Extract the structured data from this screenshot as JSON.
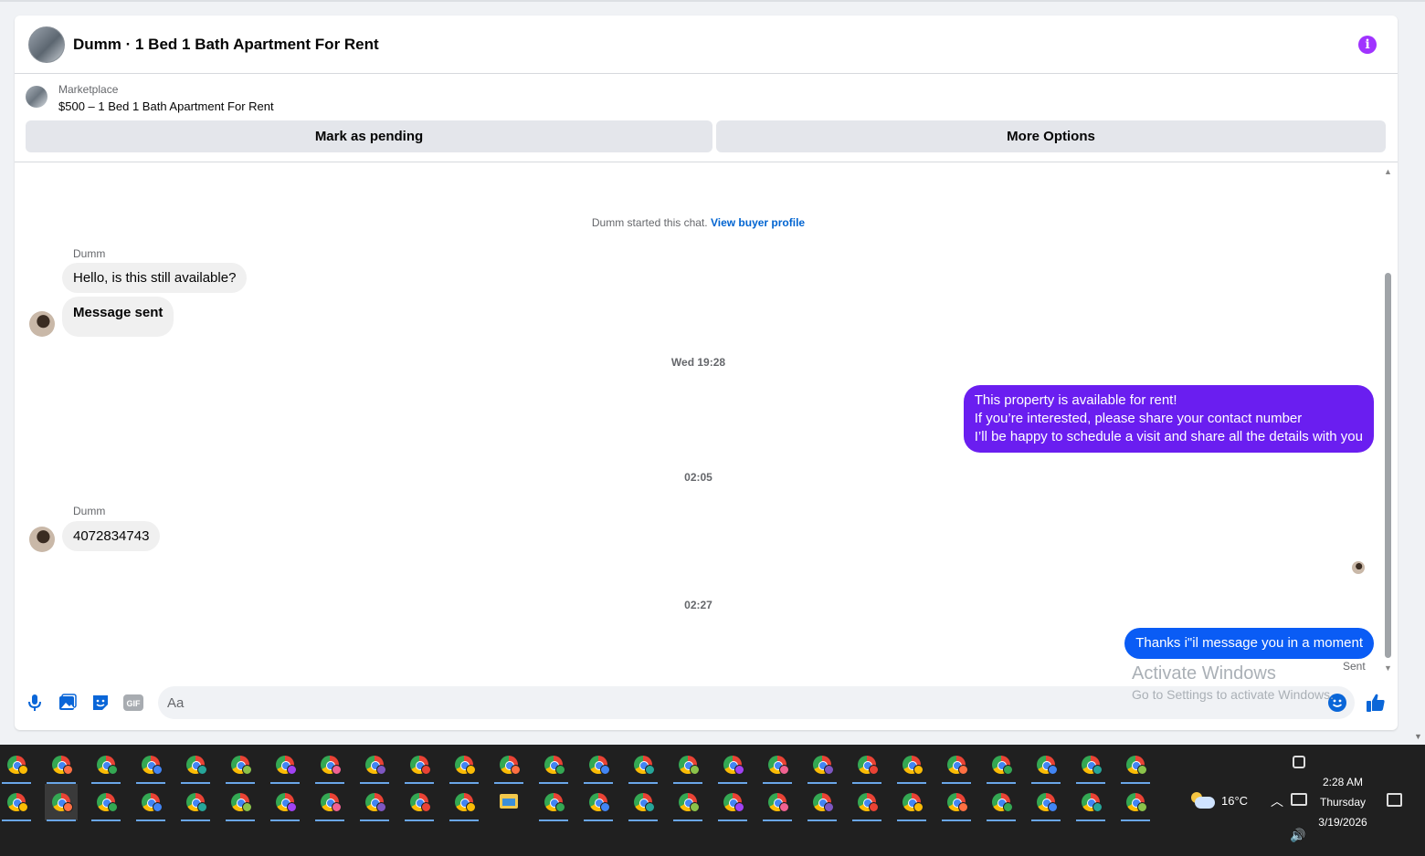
{
  "header": {
    "title": "Dumm · 1 Bed 1 Bath Apartment For Rent",
    "info_icon": "info-icon",
    "accent": "#a033ff"
  },
  "marketplace": {
    "label": "Marketplace",
    "listing": "$500 – 1 Bed 1 Bath Apartment For Rent",
    "buttons": {
      "mark_pending": "Mark as pending",
      "more_options": "More Options"
    }
  },
  "chat": {
    "system_text": "Dumm started this chat.",
    "view_buyer_profile": "View buyer profile",
    "group1": {
      "sender": "Dumm",
      "messages": [
        "Hello, is this still available?",
        "Message sent"
      ]
    },
    "timestamp1": "Wed 19:28",
    "outgoing1": [
      "This property is available for rent!",
      "If you’re interested, please share your contact number",
      "I’ll be happy to schedule a visit and share all the details with you"
    ],
    "timestamp2": "02:05",
    "group2": {
      "sender": "Dumm",
      "messages": [
        "4072834743"
      ]
    },
    "timestamp3": "02:27",
    "outgoing2": "Thanks i\"il message you in a moment",
    "status": "Sent",
    "colors": {
      "outgoing_purple": "#6a1ef0",
      "outgoing_blue": "#0a5cf5",
      "incoming": "#f0f0f0"
    }
  },
  "composer": {
    "placeholder": "Aa",
    "tools": [
      "microphone-icon",
      "photo-icon",
      "sticker-icon",
      "gif-icon"
    ],
    "gif_label": "GIF",
    "emoji_icon": "emoji-icon",
    "like_icon": "thumbs-up-icon"
  },
  "watermark": {
    "line1": "Activate Windows",
    "line2": "Go to Settings to activate Windows."
  },
  "taskbar": {
    "weather": {
      "icon": "partly-cloudy-icon",
      "temperature": "16°C"
    },
    "clock": {
      "time": "2:28 AM",
      "day": "Thursday",
      "date": "3/19/2026"
    },
    "badge_colors": [
      "#34a853",
      "#ea4335",
      "#a142f4",
      "#4285f4",
      "#fbbc05",
      "#f06292",
      "#26a69a",
      "#ff7043",
      "#7e57c2",
      "#8bc34a"
    ]
  }
}
